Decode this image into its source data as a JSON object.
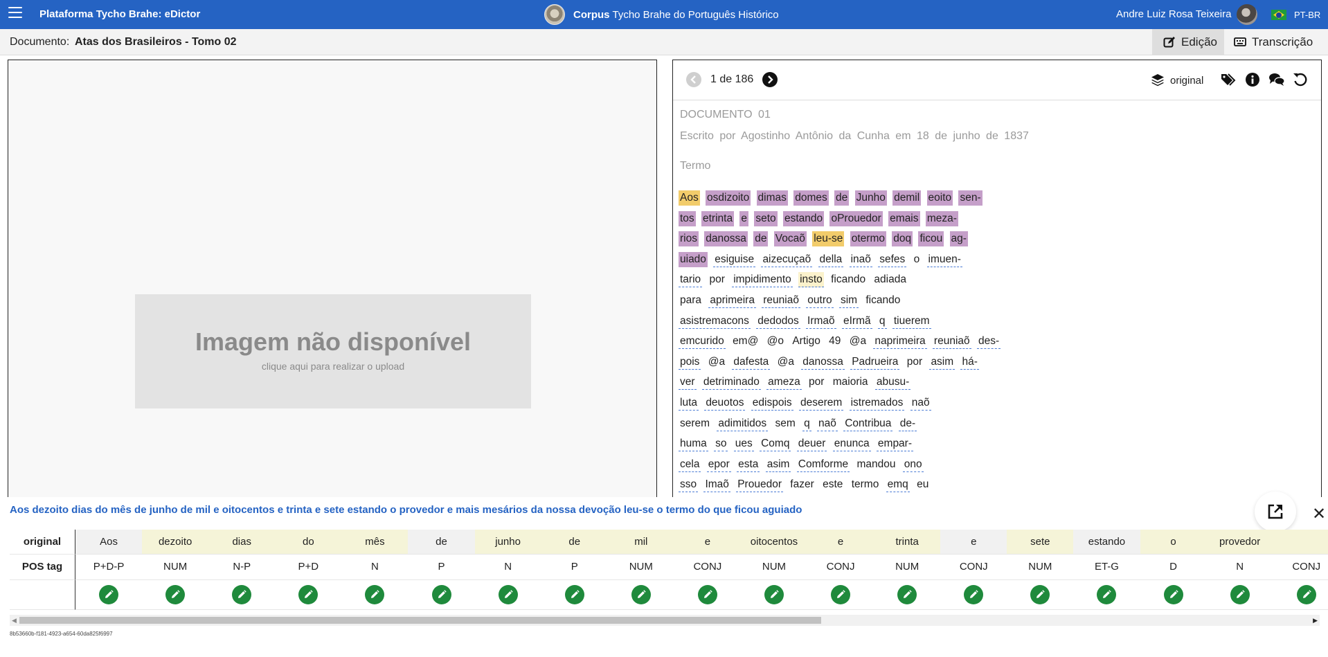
{
  "topbar": {
    "app_title": "Plataforma Tycho Brahe: eDictor",
    "corpus_bold": "Corpus",
    "corpus_rest": "Tycho Brahe do Português Histórico",
    "user_name": "Andre Luiz Rosa Teixeira",
    "language": "PT-BR"
  },
  "docbar": {
    "label": "Documento:",
    "name": "Atas dos Brasileiros - Tomo 02",
    "tabs": {
      "edit": "Edição",
      "transcription": "Transcrição"
    }
  },
  "image_panel": {
    "title": "Imagem não disponível",
    "subtitle": "clique aqui para realizar o upload"
  },
  "transcription": {
    "page_indicator": "1 de 186",
    "layer_label": "original",
    "heading": "DOCUMENTO 01",
    "author_line": "Escrito por Agostinho Antônio da Cunha em 18 de junho de 1837",
    "section": "Termo",
    "lines": [
      [
        {
          "t": "Aos",
          "s": "hl-y"
        },
        {
          "t": "osdizoito",
          "s": "hl-p"
        },
        {
          "t": "dimas",
          "s": "hl-p"
        },
        {
          "t": "domes",
          "s": "hl-p"
        },
        {
          "t": "de",
          "s": "hl-p"
        },
        {
          "t": "Junho",
          "s": "hl-p"
        },
        {
          "t": "demil",
          "s": "hl-p"
        },
        {
          "t": "eoito",
          "s": "hl-p"
        },
        {
          "t": "sen-",
          "s": "hl-p"
        }
      ],
      [
        {
          "t": "tos",
          "s": "hl-p"
        },
        {
          "t": "etrinta",
          "s": "hl-p"
        },
        {
          "t": "e",
          "s": "hl-p"
        },
        {
          "t": "seto",
          "s": "hl-p"
        },
        {
          "t": "estando",
          "s": "hl-p"
        },
        {
          "t": "oProuedor",
          "s": "hl-p"
        },
        {
          "t": "emais",
          "s": "hl-p"
        },
        {
          "t": "meza-",
          "s": "hl-p"
        }
      ],
      [
        {
          "t": "rios",
          "s": "hl-p"
        },
        {
          "t": "danossa",
          "s": "hl-p"
        },
        {
          "t": "de",
          "s": "hl-p"
        },
        {
          "t": "Vocaõ",
          "s": "hl-p"
        },
        {
          "t": "leu-se",
          "s": "hl-y"
        },
        {
          "t": "otermo",
          "s": "hl-p"
        },
        {
          "t": "doq",
          "s": "hl-p"
        },
        {
          "t": "ficou",
          "s": "hl-p"
        },
        {
          "t": "ag-",
          "s": "hl-p"
        }
      ],
      [
        {
          "t": "uiado",
          "s": "hl-p"
        },
        {
          "t": "esiguise",
          "s": ""
        },
        {
          "t": "aizecuçaõ",
          "s": ""
        },
        {
          "t": "della",
          "s": ""
        },
        {
          "t": "inaõ",
          "s": ""
        },
        {
          "t": "sefes",
          "s": ""
        },
        {
          "t": "o",
          "s": "plain"
        },
        {
          "t": "imuen-",
          "s": ""
        }
      ],
      [
        {
          "t": "tario",
          "s": ""
        },
        {
          "t": "por",
          "s": "plain"
        },
        {
          "t": "impidimento",
          "s": ""
        },
        {
          "t": "insto",
          "s": "hl-ly"
        },
        {
          "t": "ficando",
          "s": "plain"
        },
        {
          "t": "adiada",
          "s": "plain"
        }
      ],
      [
        {
          "t": "para",
          "s": "plain"
        },
        {
          "t": "aprimeira",
          "s": ""
        },
        {
          "t": "reuniaõ",
          "s": ""
        },
        {
          "t": "outro",
          "s": ""
        },
        {
          "t": "sim",
          "s": ""
        },
        {
          "t": "ficando",
          "s": "plain"
        }
      ],
      [
        {
          "t": "asistremacons",
          "s": ""
        },
        {
          "t": "dedodos",
          "s": ""
        },
        {
          "t": "Irmaõ",
          "s": ""
        },
        {
          "t": "eIrmã",
          "s": ""
        },
        {
          "t": "q",
          "s": ""
        },
        {
          "t": "tiuerem",
          "s": ""
        }
      ],
      [
        {
          "t": "emcurido",
          "s": ""
        },
        {
          "t": "em@",
          "s": "plain"
        },
        {
          "t": "@o",
          "s": "plain"
        },
        {
          "t": "Artigo",
          "s": "plain"
        },
        {
          "t": "49",
          "s": "plain"
        },
        {
          "t": "@a",
          "s": "plain"
        },
        {
          "t": "naprimeira",
          "s": ""
        },
        {
          "t": "reuniaõ",
          "s": ""
        },
        {
          "t": "des-",
          "s": ""
        }
      ],
      [
        {
          "t": "pois",
          "s": ""
        },
        {
          "t": "@a",
          "s": "plain"
        },
        {
          "t": "dafesta",
          "s": ""
        },
        {
          "t": "@a",
          "s": "plain"
        },
        {
          "t": "danossa",
          "s": ""
        },
        {
          "t": "Padrueira",
          "s": ""
        },
        {
          "t": "por",
          "s": "plain"
        },
        {
          "t": "asim",
          "s": ""
        },
        {
          "t": "há-",
          "s": ""
        }
      ],
      [
        {
          "t": "ver",
          "s": ""
        },
        {
          "t": "detriminado",
          "s": ""
        },
        {
          "t": "ameza",
          "s": ""
        },
        {
          "t": "por",
          "s": "plain"
        },
        {
          "t": "maioria",
          "s": "plain"
        },
        {
          "t": "abusu-",
          "s": ""
        }
      ],
      [
        {
          "t": "luta",
          "s": ""
        },
        {
          "t": "deuotos",
          "s": ""
        },
        {
          "t": "edispois",
          "s": ""
        },
        {
          "t": "deserem",
          "s": ""
        },
        {
          "t": "istremados",
          "s": ""
        },
        {
          "t": "naõ",
          "s": ""
        }
      ],
      [
        {
          "t": "serem",
          "s": "plain"
        },
        {
          "t": "adimitidos",
          "s": ""
        },
        {
          "t": "sem",
          "s": "plain"
        },
        {
          "t": "q",
          "s": ""
        },
        {
          "t": "naõ",
          "s": ""
        },
        {
          "t": "Contribua",
          "s": ""
        },
        {
          "t": "de-",
          "s": ""
        }
      ],
      [
        {
          "t": "huma",
          "s": ""
        },
        {
          "t": "so",
          "s": ""
        },
        {
          "t": "ues",
          "s": ""
        },
        {
          "t": "Comq",
          "s": ""
        },
        {
          "t": "deuer",
          "s": ""
        },
        {
          "t": "enunca",
          "s": ""
        },
        {
          "t": "empar-",
          "s": ""
        }
      ],
      [
        {
          "t": "cela",
          "s": ""
        },
        {
          "t": "epor",
          "s": ""
        },
        {
          "t": "esta",
          "s": ""
        },
        {
          "t": "asim",
          "s": ""
        },
        {
          "t": "Comforme",
          "s": ""
        },
        {
          "t": "mandou",
          "s": "plain"
        },
        {
          "t": "ono",
          "s": ""
        }
      ],
      [
        {
          "t": "sso",
          "s": ""
        },
        {
          "t": "Imaõ",
          "s": ""
        },
        {
          "t": "Prouedor",
          "s": ""
        },
        {
          "t": "fazer",
          "s": "plain"
        },
        {
          "t": "este",
          "s": "plain"
        },
        {
          "t": "termo",
          "s": "plain"
        },
        {
          "t": "emq",
          "s": ""
        },
        {
          "t": "eu",
          "s": "plain"
        }
      ]
    ]
  },
  "pos_panel": {
    "sentence": "Aos dezoito dias do mês de junho de mil e oitocentos e trinta e sete estando o provedor e mais mesários da nossa devoção leu-se o termo do que ficou aguiado",
    "header_words": "original",
    "header_tags": "POS tag",
    "words": [
      "Aos",
      "dezoito",
      "dias",
      "do",
      "mês",
      "de",
      "junho",
      "de",
      "mil",
      "e",
      "oitocentos",
      "e",
      "trinta",
      "e",
      "sete",
      "estando",
      "o",
      "provedor",
      ""
    ],
    "tags": [
      "P+D-P",
      "NUM",
      "N-P",
      "P+D",
      "N",
      "P",
      "N",
      "P",
      "NUM",
      "CONJ",
      "NUM",
      "CONJ",
      "NUM",
      "CONJ",
      "NUM",
      "ET-G",
      "D",
      "N",
      "CONJ"
    ],
    "word_shading": [
      "g",
      "y",
      "y",
      "y",
      "y",
      "g",
      "y",
      "y",
      "y",
      "y",
      "y",
      "y",
      "y",
      "g",
      "y",
      "g",
      "y",
      "y",
      "y"
    ],
    "document_id": "8b53660b-f181-4923-a654-60da825f6997"
  },
  "colors": {
    "topbar": "#2563c3",
    "highlight_purple": "#c59fc9",
    "highlight_yellow": "#f2cc6b",
    "edit_button": "#1f8a3c"
  },
  "icons": [
    "menu-icon",
    "corpus-logo",
    "user-avatar",
    "brazil-flag-icon",
    "edit-icon",
    "keyboard-icon",
    "chevron-left-icon",
    "chevron-right-icon",
    "layers-icon",
    "tags-icon",
    "info-icon",
    "comments-icon",
    "undo-icon",
    "external-link-icon",
    "close-icon",
    "pencil-icon"
  ]
}
